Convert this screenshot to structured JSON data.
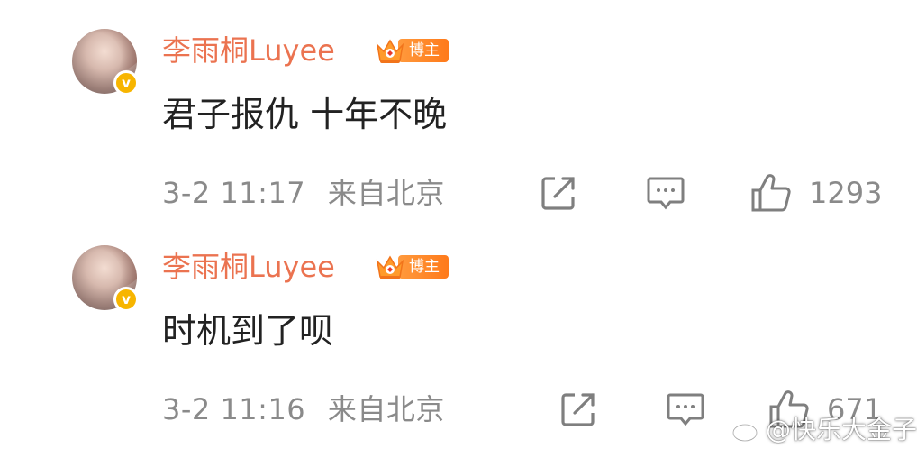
{
  "comments": [
    {
      "username": "李雨桐Luyee",
      "badge_label": "博主",
      "text": "君子报仇 十年不晚",
      "time": "3-2 11:17",
      "source": "来自北京",
      "likes": "1293"
    },
    {
      "username": "李雨桐Luyee",
      "badge_label": "博主",
      "text": "时机到了呗",
      "time": "3-2 11:16",
      "source": "来自北京",
      "likes": "671"
    }
  ],
  "watermark": {
    "text": "@快乐大金子"
  },
  "colors": {
    "username": "#eb7350",
    "meta": "#8a8a8a",
    "badge": "#ff8a2a",
    "verified": "#f7b500"
  },
  "icons": [
    "share-icon",
    "comment-icon",
    "like-icon",
    "crown-icon",
    "verified-icon",
    "weibo-logo-icon"
  ]
}
